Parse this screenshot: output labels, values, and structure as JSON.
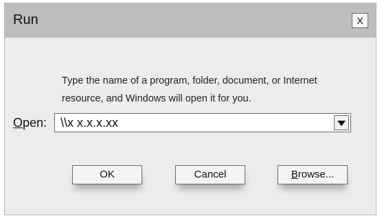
{
  "window": {
    "title": "Run",
    "close_label": "X"
  },
  "description": {
    "line1": "Type the name of a program, folder, document, or Internet",
    "line2": "resource, and Windows will open it for you."
  },
  "open_field": {
    "label_mnemonic": "O",
    "label_rest": "pen:",
    "value": "\\\\x x.x.x.xx",
    "dropdown_icon": "chevron-down-icon"
  },
  "buttons": {
    "ok_label": "OK",
    "cancel_label": "Cancel",
    "browse_mnemonic": "B",
    "browse_rest": "rowse..."
  },
  "colors": {
    "titlebar": "#bdbdbd",
    "body": "#ececec"
  }
}
